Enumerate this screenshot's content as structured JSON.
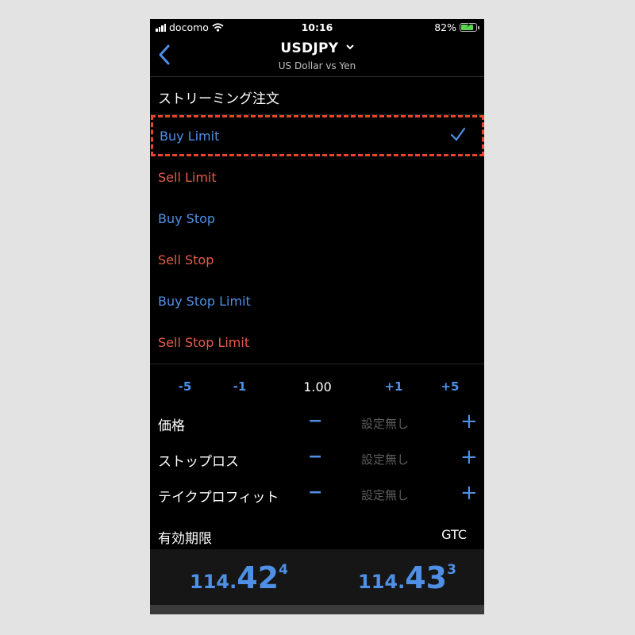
{
  "status_bar": {
    "carrier": "docomo",
    "time": "10:16",
    "battery_percent": "82%",
    "battery_level": 0.82
  },
  "header": {
    "symbol": "USDJPY",
    "description": "US Dollar vs Yen"
  },
  "order_section": {
    "title": "ストリーミング注文"
  },
  "order_types": [
    {
      "label": "Buy Limit",
      "color": "#4f8fe6",
      "selected": true
    },
    {
      "label": "Sell Limit",
      "color": "#e85b4a",
      "selected": false
    },
    {
      "label": "Buy Stop",
      "color": "#4f8fe6",
      "selected": false
    },
    {
      "label": "Sell Stop",
      "color": "#e85b4a",
      "selected": false
    },
    {
      "label": "Buy Stop Limit",
      "color": "#4f8fe6",
      "selected": false
    },
    {
      "label": "Sell Stop Limit",
      "color": "#e85b4a",
      "selected": false
    }
  ],
  "volume_stepper": {
    "minus5": "-5",
    "minus1": "-1",
    "value": "1.00",
    "plus1": "+1",
    "plus5": "+5"
  },
  "fields": [
    {
      "label": "価格",
      "value": "設定無し"
    },
    {
      "label": "ストップロス",
      "value": "設定無し"
    },
    {
      "label": "テイクプロフィット",
      "value": "設定無し"
    }
  ],
  "expiry": {
    "label": "有効期限",
    "value": "GTC"
  },
  "quotes": {
    "bid": {
      "prefix": "114.",
      "big": "42",
      "sup": "4"
    },
    "ask": {
      "prefix": "114.",
      "big": "43",
      "sup": "3"
    }
  },
  "colors": {
    "accent_blue": "#4f8fe6",
    "sell_red": "#e85b4a",
    "highlight": "#e8452c",
    "background": "#000000"
  }
}
